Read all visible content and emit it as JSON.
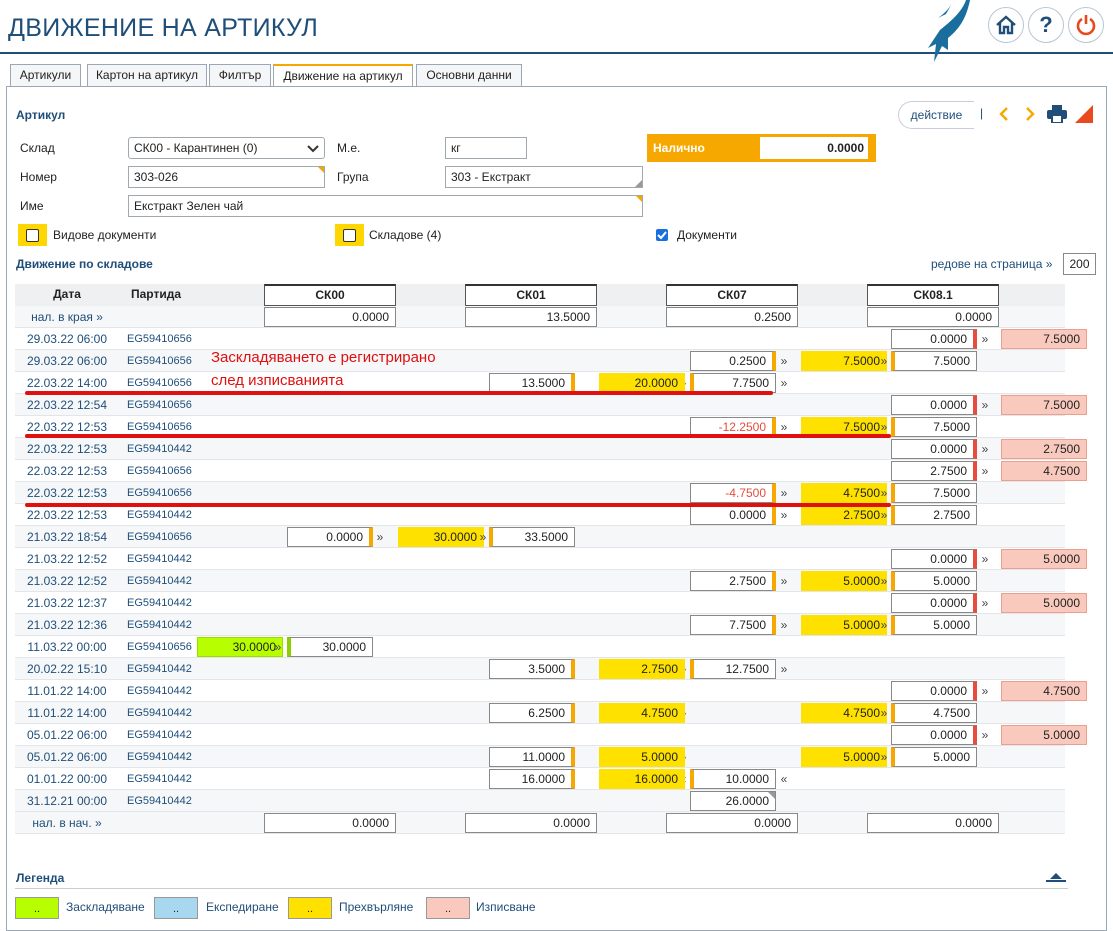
{
  "page_title": "ДВИЖЕНИЕ НА АРТИКУЛ",
  "tabs": [
    "Артикули",
    "Картон на артикул",
    "Филтър",
    "Движение на артикул",
    "Основни данни"
  ],
  "section_article": "Артикул",
  "action_label": "действие",
  "action_sep": "|",
  "form": {
    "sklad_label": "Склад",
    "sklad_value": "СК00 - Карантинен (0)",
    "me_label": "М.е.",
    "me_value": "кг",
    "available_label": "Налично",
    "available_value": "0.0000",
    "nomer_label": "Номер",
    "nomer_value": "303-026",
    "grupa_label": "Група",
    "grupa_value": "303 - Екстракт",
    "ime_label": "Име",
    "ime_value": "Екстракт Зелен чай"
  },
  "checks": {
    "doc_types": "Видове документи",
    "warehouses": "Складове (4)",
    "documents": "Документи"
  },
  "section_movement": "Движение по складове",
  "rows_per_page_label": "редове на страница »",
  "rows_per_page": "200",
  "table": {
    "col_date": "Дата",
    "col_batch": "Партида",
    "wh": [
      "СК00",
      "СК01",
      "СК07",
      "СК08.1"
    ],
    "end_label": "нал. в края »",
    "end": [
      "0.0000",
      "13.5000",
      "0.2500",
      "0.0000"
    ],
    "start_label": "нал. в нач. »",
    "start": [
      "0.0000",
      "0.0000",
      "0.0000",
      "0.0000"
    ],
    "rows": [
      {
        "d": "29.03.22 06:00",
        "b": "EG59410656"
      },
      {
        "d": "29.03.22 06:00",
        "b": "EG59410656"
      },
      {
        "d": "22.03.22 14:00",
        "b": "EG59410656"
      },
      {
        "d": "22.03.22 12:54",
        "b": "EG59410656"
      },
      {
        "d": "22.03.22 12:53",
        "b": "EG59410656"
      },
      {
        "d": "22.03.22 12:53",
        "b": "EG59410442"
      },
      {
        "d": "22.03.22 12:53",
        "b": "EG59410656"
      },
      {
        "d": "22.03.22 12:53",
        "b": "EG59410656"
      },
      {
        "d": "22.03.22 12:53",
        "b": "EG59410442"
      },
      {
        "d": "21.03.22 18:54",
        "b": "EG59410656"
      },
      {
        "d": "21.03.22 12:52",
        "b": "EG59410442"
      },
      {
        "d": "21.03.22 12:52",
        "b": "EG59410442"
      },
      {
        "d": "21.03.22 12:37",
        "b": "EG59410442"
      },
      {
        "d": "21.03.22 12:36",
        "b": "EG59410442"
      },
      {
        "d": "11.03.22 00:00",
        "b": "EG59410656"
      },
      {
        "d": "20.02.22 15:10",
        "b": "EG59410442"
      },
      {
        "d": "11.01.22 14:00",
        "b": "EG59410442"
      },
      {
        "d": "11.01.22 14:00",
        "b": "EG59410442"
      },
      {
        "d": "05.01.22 06:00",
        "b": "EG59410442"
      },
      {
        "d": "05.01.22 06:00",
        "b": "EG59410442"
      },
      {
        "d": "01.01.22 00:00",
        "b": "EG59410442"
      },
      {
        "d": "31.12.21 00:00",
        "b": "EG59410442"
      }
    ]
  },
  "cells": {
    "r0": [
      "0.0000",
      "»",
      "7.5000"
    ],
    "r1": [
      "0.2500",
      "»",
      "7.5000",
      "»",
      "7.5000"
    ],
    "r2": [
      "13.5000",
      "»",
      "20.0000",
      "»",
      "7.7500"
    ],
    "r3": [
      "0.0000",
      "»",
      "7.5000"
    ],
    "r4": [
      "-12.2500",
      "»",
      "7.5000",
      "»",
      "7.5000"
    ],
    "r5": [
      "0.0000",
      "»",
      "2.7500"
    ],
    "r6": [
      "2.7500",
      "»",
      "4.7500"
    ],
    "r7": [
      "-4.7500",
      "»",
      "4.7500",
      "»",
      "7.5000"
    ],
    "r8": [
      "0.0000",
      "»",
      "2.7500",
      "»",
      "2.7500"
    ],
    "r9": [
      "0.0000",
      "»",
      "30.0000",
      "»",
      "33.5000"
    ],
    "r10": [
      "0.0000",
      "»",
      "5.0000"
    ],
    "r11": [
      "2.7500",
      "»",
      "5.0000",
      "»",
      "5.0000"
    ],
    "r12": [
      "0.0000",
      "»",
      "5.0000"
    ],
    "r13": [
      "7.7500",
      "»",
      "5.0000",
      "»",
      "5.0000"
    ],
    "r14": [
      "30.0000",
      "»",
      "30.0000"
    ],
    "r15": [
      "3.5000",
      "»",
      "2.7500",
      "»",
      "12.7500"
    ],
    "r16": [
      "0.0000",
      "»",
      "4.7500"
    ],
    "r17": [
      "6.2500",
      "»",
      "4.7500",
      "4.7500",
      "»",
      "4.7500"
    ],
    "r18": [
      "0.0000",
      "»",
      "5.0000"
    ],
    "r19": [
      "11.0000",
      "»",
      "5.0000",
      "5.0000",
      "»",
      "5.0000"
    ],
    "r20": [
      "16.0000",
      "«",
      "16.0000",
      "«",
      "10.0000"
    ],
    "r21": [
      "26.0000"
    ]
  },
  "note_line1": "Заскладяването е регистрирано",
  "note_line2": "след изписванията",
  "legend_title": "Легенда",
  "legend": [
    {
      "sym": "..",
      "label": "Заскладяване",
      "color": "#b7ff00"
    },
    {
      "sym": "..",
      "label": "Експедиране",
      "color": "#a8d8f0"
    },
    {
      "sym": "..",
      "label": "Прехвърляне",
      "color": "#ffe100"
    },
    {
      "sym": "..",
      "label": "Изписване",
      "color": "#f9c9bd"
    }
  ]
}
